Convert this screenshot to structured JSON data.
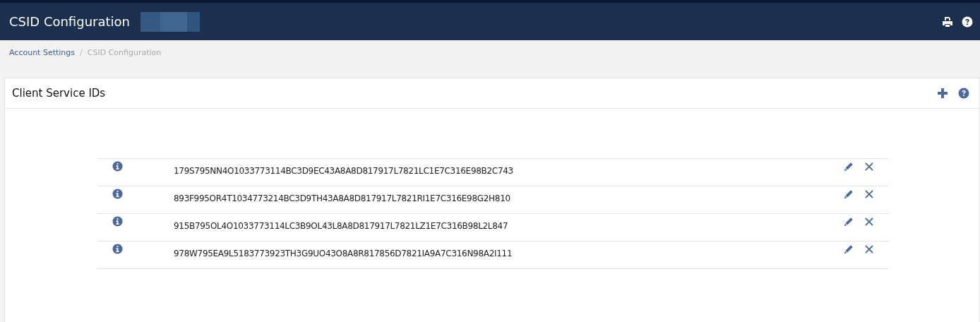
{
  "header": {
    "title": "CSID Configuration"
  },
  "breadcrumb": [
    {
      "label": "Account Settings",
      "kind": "link",
      "separator": "/"
    },
    {
      "label": "CSID Configuration",
      "kind": "current"
    }
  ],
  "panel": {
    "title": "Client Service IDs"
  },
  "rows": [
    {
      "id": "179S795NN4O1033773114BC3D9EC43A8A8D817917L7821LC1E7C316E98B2C743"
    },
    {
      "id": "893F995OR4T1034773214BC3D9TH43A8A8D817917L7821RI1E7C316E98G2H810"
    },
    {
      "id": "915B795OL4O1033773114LC3B9OL43L8A8D817917L7821LZ1E7C316B98L2L847"
    },
    {
      "id": "978W795EA9L5183773923TH3G9UO43O8A8R817856D7821IA9A7C316N98A2I111"
    }
  ]
}
